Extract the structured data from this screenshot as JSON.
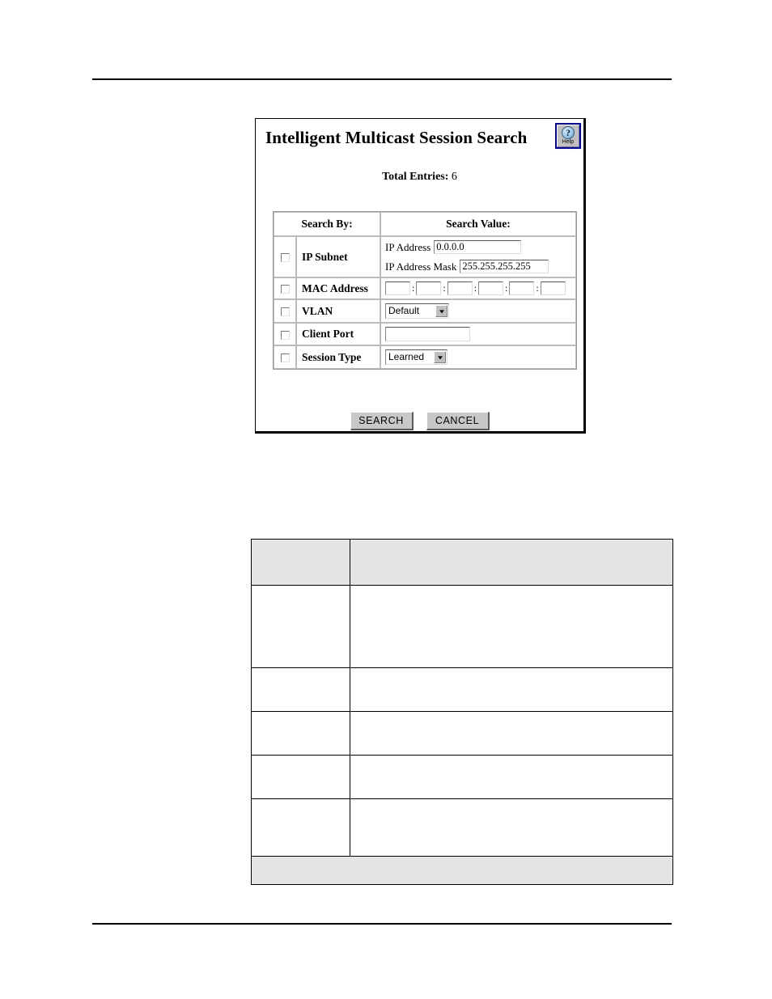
{
  "document": {
    "rules": {
      "top_visible": true,
      "bottom_visible": true
    }
  },
  "app_panel": {
    "title": "Intelligent Multicast Session Search",
    "help_button": {
      "glyph": "?",
      "label": "Help",
      "border_color": "#0000b4",
      "icon_name": "help-question-icon"
    },
    "total_entries": {
      "label": "Total Entries:",
      "value": "6"
    },
    "search_table": {
      "headers": {
        "search_by": "Search By:",
        "search_value": "Search Value:"
      },
      "rows": [
        {
          "id": "ip-subnet",
          "label": "IP Subnet",
          "checked": false,
          "fields": [
            {
              "label": "IP Address",
              "value": "0.0.0.0",
              "placeholder": ""
            },
            {
              "label": "IP Address Mask",
              "value": "255.255.255.255",
              "placeholder": ""
            }
          ]
        },
        {
          "id": "mac-address",
          "label": "MAC Address",
          "checked": false,
          "octets": [
            "",
            "",
            "",
            "",
            "",
            ""
          ],
          "separator": ":"
        },
        {
          "id": "vlan",
          "label": "VLAN",
          "checked": false,
          "selected": "Default",
          "options": [
            "Default"
          ]
        },
        {
          "id": "client-port",
          "label": "Client Port",
          "checked": false,
          "value": "",
          "placeholder": ""
        },
        {
          "id": "session-type",
          "label": "Session Type",
          "checked": false,
          "selected": "Learned",
          "options": [
            "Learned"
          ]
        }
      ]
    },
    "actions": {
      "search_label": "SEARCH",
      "cancel_label": "CANCEL"
    }
  },
  "description_table": {
    "header": {
      "col1": "",
      "col2": ""
    },
    "rows": [
      {
        "col1": "",
        "col2": ""
      },
      {
        "col1": "",
        "col2": ""
      },
      {
        "col1": "",
        "col2": ""
      },
      {
        "col1": "",
        "col2": ""
      },
      {
        "col1": "",
        "col2": ""
      }
    ],
    "footer": {
      "text": ""
    }
  },
  "colors": {
    "help_border": "#0000b4",
    "panel_border": "#000000",
    "table_shade": "#e4e4e4",
    "button_face": "#c8c8c8"
  }
}
